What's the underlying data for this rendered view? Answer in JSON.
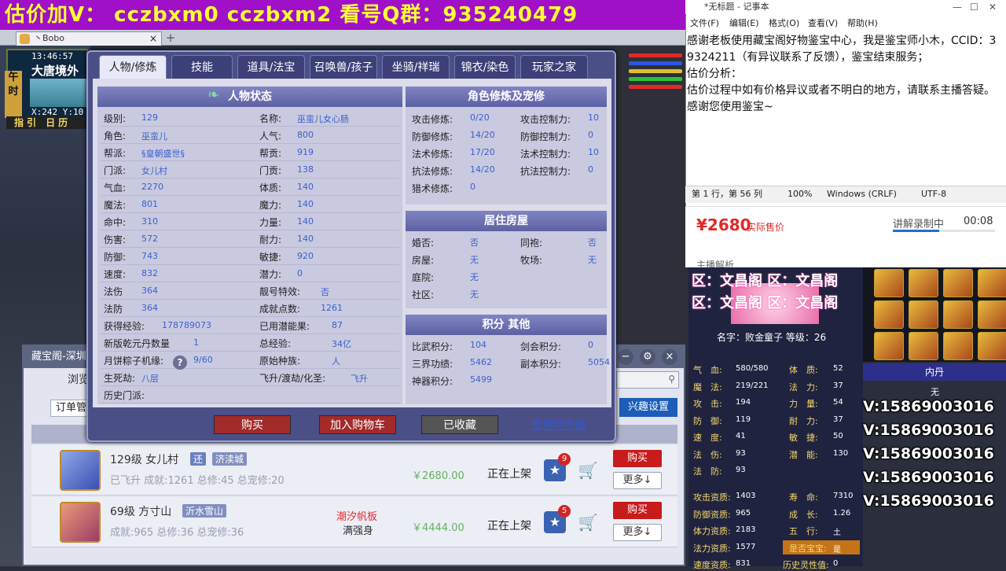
{
  "banner": "估价加V：  cczbxm0   cczbxm2   看号Q群：935240479",
  "browser": {
    "tab_title": "丶Bobo",
    "tab_close": "×",
    "new_tab": "+"
  },
  "game_hud": {
    "clock": "13:46:57",
    "location": "大唐境外",
    "coords": "X:242 Y:10",
    "guide": "指引 日历",
    "side_label": "午时"
  },
  "dialog": {
    "tabs": [
      "人物/修炼",
      "技能",
      "道具/法宝",
      "召唤兽/孩子",
      "坐骑/祥瑞",
      "锦衣/染色",
      "玩家之家"
    ],
    "active_tab": 0,
    "status_section": {
      "title": "人物状态",
      "left": [
        {
          "label": "级别:",
          "value": "129"
        },
        {
          "label": "角色:",
          "value": "巫蛮儿"
        },
        {
          "label": "帮派:",
          "value": "§皇朝盛世§"
        },
        {
          "label": "门派:",
          "value": "女儿村"
        },
        {
          "label": "气血:",
          "value": "2270"
        },
        {
          "label": "魔法:",
          "value": "801"
        },
        {
          "label": "命中:",
          "value": "310"
        },
        {
          "label": "伤害:",
          "value": "572"
        },
        {
          "label": "防御:",
          "value": "743"
        },
        {
          "label": "速度:",
          "value": "832"
        },
        {
          "label": "法伤",
          "value": "364"
        },
        {
          "label": "法防",
          "value": "364"
        },
        {
          "label": "获得经验:",
          "value": "178789073"
        },
        {
          "label": "新版乾元丹数量",
          "value": "1"
        },
        {
          "label": "月饼粽子机缘:",
          "value": "9/60"
        },
        {
          "label": "生死劫:",
          "value": "八层"
        },
        {
          "label": "历史门派:",
          "value": ""
        }
      ],
      "right": [
        {
          "label": "名称:",
          "value": "巫蛮儿女心肠"
        },
        {
          "label": "人气:",
          "value": "800"
        },
        {
          "label": "帮贡:",
          "value": "919"
        },
        {
          "label": "门贡:",
          "value": "138"
        },
        {
          "label": "体质:",
          "value": "140"
        },
        {
          "label": "魔力:",
          "value": "140"
        },
        {
          "label": "力量:",
          "value": "140"
        },
        {
          "label": "耐力:",
          "value": "140"
        },
        {
          "label": "敏捷:",
          "value": "920"
        },
        {
          "label": "潜力:",
          "value": "0"
        },
        {
          "label": "靓号特效:",
          "value": "否"
        },
        {
          "label": "成就点数:",
          "value": "1261"
        },
        {
          "label": "已用潜能果:",
          "value": "87"
        },
        {
          "label": "总经验:",
          "value": "34亿"
        },
        {
          "label": "原始种族:",
          "value": "人"
        },
        {
          "label": "飞升/渡劫/化圣:",
          "value": "飞升"
        }
      ]
    },
    "cultivation_section": {
      "title": "角色修炼及宠修",
      "rows": [
        {
          "l1": "攻击修炼:",
          "v1": "0/20",
          "l2": "攻击控制力:",
          "v2": "10"
        },
        {
          "l1": "防御修炼:",
          "v1": "14/20",
          "l2": "防御控制力:",
          "v2": "0"
        },
        {
          "l1": "法术修炼:",
          "v1": "17/20",
          "l2": "法术控制力:",
          "v2": "10"
        },
        {
          "l1": "抗法修炼:",
          "v1": "14/20",
          "l2": "抗法控制力:",
          "v2": "0"
        },
        {
          "l1": "猎术修炼:",
          "v1": "0",
          "l2": "",
          "v2": ""
        }
      ]
    },
    "house_section": {
      "title": "居住房屋",
      "rows": [
        {
          "l1": "婚否:",
          "v1": "否",
          "l2": "同袍:",
          "v2": "否"
        },
        {
          "l1": "房屋:",
          "v1": "无",
          "l2": "牧场:",
          "v2": "无"
        },
        {
          "l1": "庭院:",
          "v1": "无",
          "l2": "",
          "v2": ""
        },
        {
          "l1": "社区:",
          "v1": "无",
          "l2": "",
          "v2": ""
        }
      ]
    },
    "points_section": {
      "title": "积分 其他",
      "rows": [
        {
          "l1": "比武积分:",
          "v1": "104",
          "l2": "剑会积分:",
          "v2": "0"
        },
        {
          "l1": "三界功绩:",
          "v1": "5462",
          "l2": "副本积分:",
          "v2": "5054"
        },
        {
          "l1": "神器积分:",
          "v1": "5499",
          "l2": "",
          "v2": ""
        }
      ]
    },
    "buttons": {
      "buy": "购买",
      "cart": "加入购物车",
      "favorited": "已收藏",
      "web": "使用网页版"
    }
  },
  "store": {
    "title": "藏宝阁-深圳",
    "browse": "浏览",
    "order_label": "订单管",
    "interest": "兴趣设置",
    "listings": [
      {
        "title": "129级  女儿村",
        "tag1": "还",
        "server": "济渎城",
        "sub": "已飞升  成就:1261  总修:45  总宠修:20",
        "note": "",
        "note2": "",
        "price": "￥2680.00",
        "status": "正在上架",
        "fav": "9",
        "buy": "购买",
        "more": "更多↓"
      },
      {
        "title": "69级  方寸山",
        "tag1": "",
        "server": "沂水雪山",
        "sub": "成就:965  总修:36  总宠修:36",
        "note": "潮汐帆板",
        "note2": "满强身",
        "price": "￥4444.00",
        "status": "正在上架",
        "fav": "5",
        "buy": "购买",
        "more": "更多↓"
      }
    ]
  },
  "notepad": {
    "title": "*无标题 - 记事本",
    "menu": [
      "文件(F)",
      "编辑(E)",
      "格式(O)",
      "查看(V)",
      "帮助(H)"
    ],
    "text": "感谢老板使用藏宝阁好物鉴宝中心，我是鉴宝师小木，CCID：39324211（有异议联系了反馈），鉴宝结束服务；\n估价分析：\n估价过程中如有价格异议或者不明白的地方，请联系主播答疑。感谢您使用鉴宝~",
    "status": {
      "pos": "第 1 行，第 56 列",
      "zoom": "100%",
      "eol": "Windows (CRLF)",
      "enc": "UTF-8"
    }
  },
  "price_panel": {
    "price": "¥2680",
    "price_label": "实际售价",
    "rec_label": "讲解录制中",
    "rec_time": "00:08",
    "rec_progress": 0.45,
    "analysis": "主播解析"
  },
  "pet": {
    "zone_lines": [
      "区：文昌阁 区：文昌阁",
      "区：文昌阁 区：文昌阁"
    ],
    "name": "名字：败金童子  等级：26",
    "stats_left": [
      {
        "label": "气　血:",
        "value": "580/580"
      },
      {
        "label": "魔　法:",
        "value": "219/221"
      },
      {
        "label": "攻　击:",
        "value": "194"
      },
      {
        "label": "防　御:",
        "value": "119"
      },
      {
        "label": "速　度:",
        "value": "41"
      },
      {
        "label": "法　伤:",
        "value": "93"
      },
      {
        "label": "法　防:",
        "value": "93"
      }
    ],
    "stats_right": [
      {
        "label": "体　质:",
        "value": "52"
      },
      {
        "label": "法　力:",
        "value": "37"
      },
      {
        "label": "力　量:",
        "value": "54"
      },
      {
        "label": "耐　力:",
        "value": "37"
      },
      {
        "label": "敏　捷:",
        "value": "50"
      },
      {
        "label": "潜　能:",
        "value": "130"
      }
    ],
    "aptitude_left": [
      {
        "label": "攻击资质:",
        "value": "1403"
      },
      {
        "label": "防御资质:",
        "value": "965"
      },
      {
        "label": "体力资质:",
        "value": "2183"
      },
      {
        "label": "法力资质:",
        "value": "1577"
      },
      {
        "label": "速度资质:",
        "value": "831"
      }
    ],
    "aptitude_right": [
      {
        "label": "寿　命:",
        "value": "7310"
      },
      {
        "label": "成　长:",
        "value": "1.26"
      },
      {
        "label": "五　行:",
        "value": "土"
      },
      {
        "label": "是否宝宝:",
        "value": "是"
      },
      {
        "label": "历史灵性值:",
        "value": "0"
      }
    ],
    "neidan_title": "内丹",
    "neidan_value": "无"
  },
  "contact_lines": [
    "V:15869003016",
    "V:15869003016",
    "V:15869003016",
    "V:15869003016",
    "V:15869003016"
  ]
}
